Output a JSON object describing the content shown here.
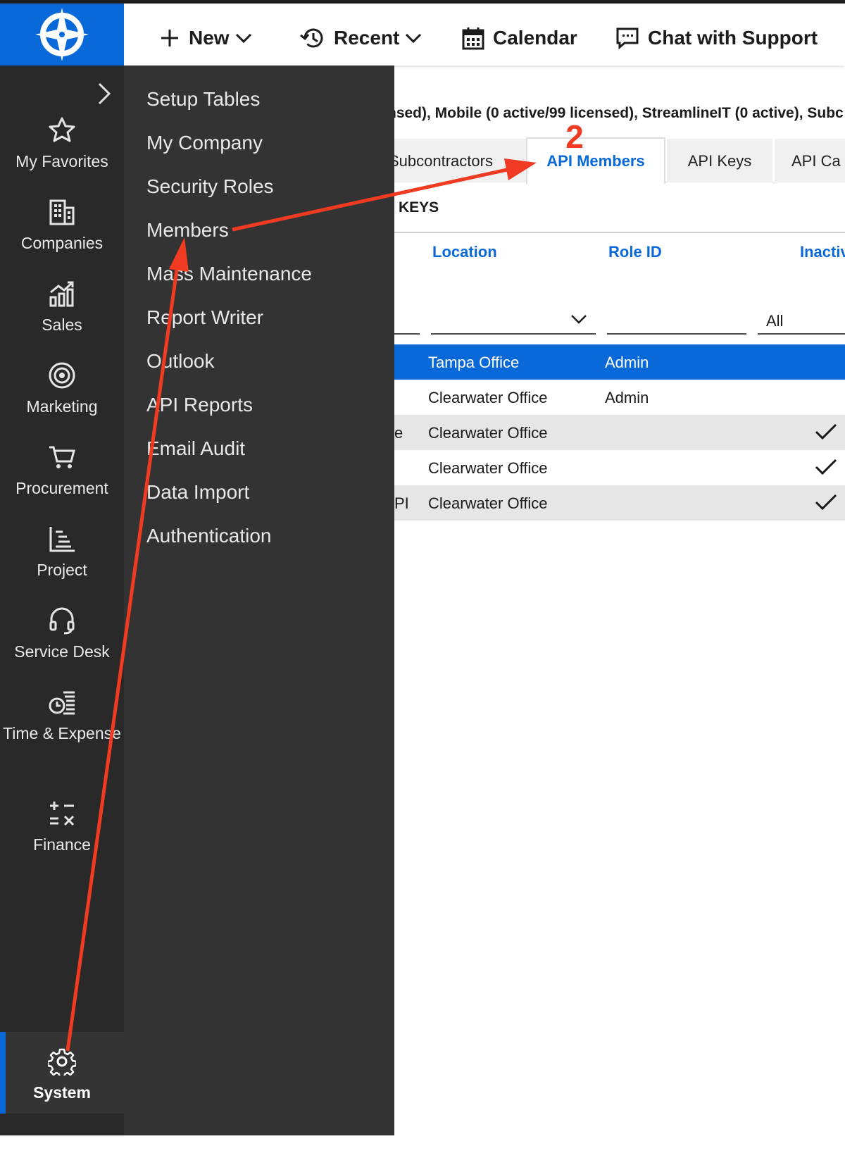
{
  "topbar": {
    "items": [
      {
        "label": "New",
        "icon": "plus-icon",
        "dropdown": true
      },
      {
        "label": "Recent",
        "icon": "history-icon",
        "dropdown": true
      },
      {
        "label": "Calendar",
        "icon": "calendar-icon",
        "dropdown": false
      },
      {
        "label": "Chat with Support",
        "icon": "chat-icon",
        "dropdown": false
      }
    ]
  },
  "sidebar": {
    "items": [
      {
        "label": "My Favorites",
        "icon": "star-icon"
      },
      {
        "label": "Companies",
        "icon": "building-icon"
      },
      {
        "label": "Sales",
        "icon": "sales-chart-icon"
      },
      {
        "label": "Marketing",
        "icon": "target-icon"
      },
      {
        "label": "Procurement",
        "icon": "cart-icon"
      },
      {
        "label": "Project",
        "icon": "project-icon"
      },
      {
        "label": "Service Desk",
        "icon": "headset-icon"
      },
      {
        "label": "Time & Expense",
        "icon": "time-expense-icon"
      },
      {
        "label": "Finance",
        "icon": "finance-icon"
      },
      {
        "label": "System",
        "icon": "gear-icon",
        "active": true
      }
    ]
  },
  "flyout": {
    "items": [
      {
        "label": "Setup Tables"
      },
      {
        "label": "My Company"
      },
      {
        "label": "Security Roles"
      },
      {
        "label": "Members"
      },
      {
        "label": "Mass Maintenance"
      },
      {
        "label": "Report Writer"
      },
      {
        "label": "Outlook"
      },
      {
        "label": "API Reports"
      },
      {
        "label": "Email Audit"
      },
      {
        "label": "Data Import"
      },
      {
        "label": "Authentication"
      }
    ]
  },
  "content": {
    "license_text": "nsed), Mobile (0 active/99 licensed), StreamlineIT (0 active), Subc",
    "tabs": [
      {
        "label": "Subcontractors"
      },
      {
        "label": "API Members",
        "active": true
      },
      {
        "label": "API Keys"
      },
      {
        "label": "API Ca"
      }
    ],
    "section_title": "KEYS",
    "columns": [
      {
        "label": "Location"
      },
      {
        "label": "Role ID"
      },
      {
        "label": "Inactiv"
      }
    ],
    "filters": {
      "inactive_value": "All"
    },
    "rows": [
      {
        "c0": "",
        "location": "Tampa Office",
        "role": "Admin",
        "inactive": false,
        "selected": true
      },
      {
        "c0": "",
        "location": "Clearwater Office",
        "role": "Admin",
        "inactive": false,
        "selected": false
      },
      {
        "c0": "e",
        "location": "Clearwater Office",
        "role": "",
        "inactive": true,
        "selected": false
      },
      {
        "c0": "",
        "location": "Clearwater Office",
        "role": "",
        "inactive": true,
        "selected": false
      },
      {
        "c0": "PI",
        "location": "Clearwater Office",
        "role": "",
        "inactive": true,
        "selected": false
      }
    ]
  },
  "annotation": {
    "step_number": "2",
    "arrow_color": "#f03a22"
  },
  "colors": {
    "brand_blue": "#0a69d9",
    "nav_bg": "#292929",
    "flyout_bg": "#333333",
    "annotation_red": "#f03a22"
  }
}
